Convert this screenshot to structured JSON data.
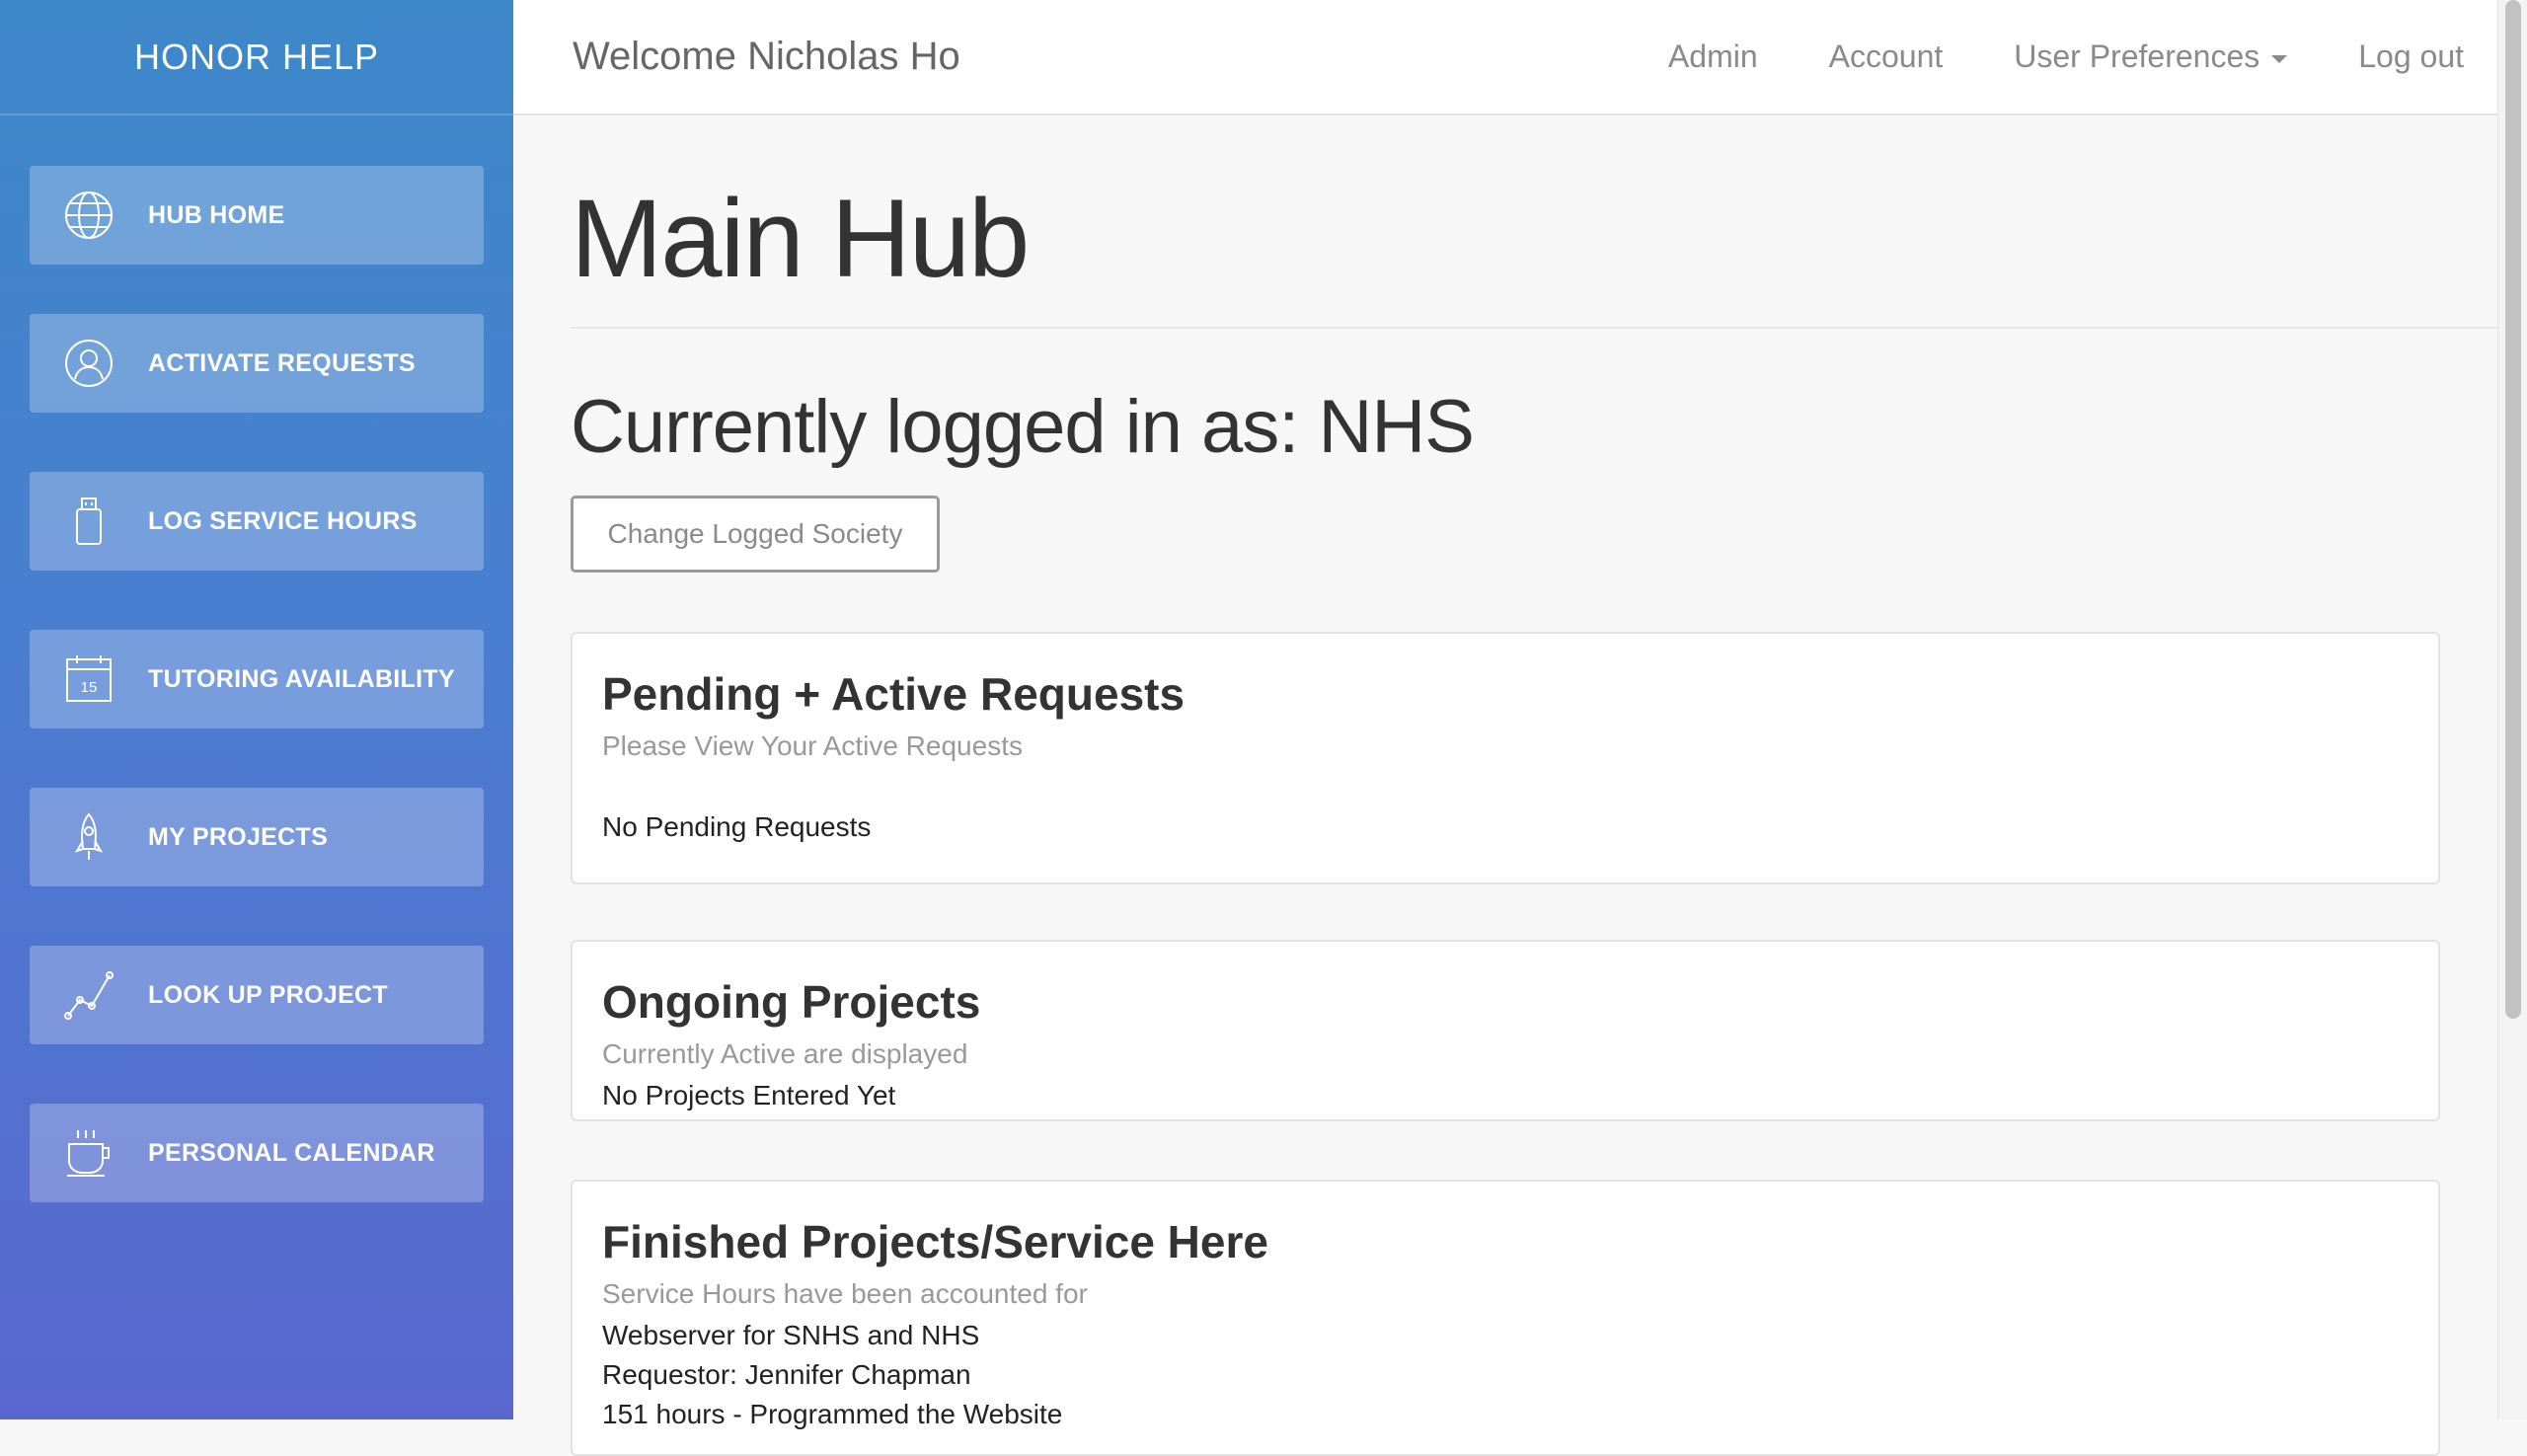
{
  "app": {
    "brand": "HONOR HELP"
  },
  "sidebar": {
    "items": [
      {
        "label": "HUB HOME",
        "icon": "globe-icon"
      },
      {
        "label": "ACTIVATE REQUESTS",
        "icon": "user-icon"
      },
      {
        "label": "LOG SERVICE HOURS",
        "icon": "usb-drive-icon"
      },
      {
        "label": "TUTORING AVAILABILITY",
        "icon": "calendar-icon",
        "icon_text": "15"
      },
      {
        "label": "MY PROJECTS",
        "icon": "rocket-icon"
      },
      {
        "label": "LOOK UP PROJECT",
        "icon": "line-chart-icon"
      },
      {
        "label": "PERSONAL CALENDAR",
        "icon": "coffee-cup-icon"
      }
    ]
  },
  "topbar": {
    "welcome": "Welcome Nicholas Ho",
    "nav": {
      "admin": "Admin",
      "account": "Account",
      "preferences": "User Preferences",
      "logout": "Log out"
    }
  },
  "main": {
    "title": "Main Hub",
    "logged_in_label": "Currently logged in as: ",
    "logged_in_value": "NHS",
    "change_button": "Change Logged Society",
    "cards": {
      "pending": {
        "title": "Pending + Active Requests",
        "subtitle": "Please View Your Active Requests",
        "body": "No Pending Requests"
      },
      "ongoing": {
        "title": "Ongoing Projects",
        "subtitle": "Currently Active are displayed",
        "body": "No Projects Entered Yet"
      },
      "finished": {
        "title": "Finished Projects/Service Here",
        "subtitle": "Service Hours have been accounted for",
        "lines": [
          "Webserver for SNHS and NHS",
          "Requestor: Jennifer Chapman",
          "151 hours - Programmed the Website"
        ]
      }
    }
  },
  "colors": {
    "sidebar_top": "#3d88c9",
    "sidebar_bottom": "#5a67cf",
    "background": "#f7f7f7"
  }
}
